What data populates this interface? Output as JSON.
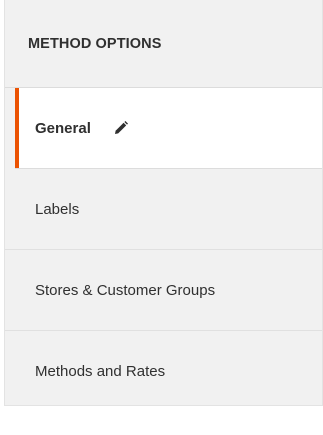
{
  "panel": {
    "title": "METHOD OPTIONS"
  },
  "nav": {
    "items": [
      {
        "label": "General",
        "active": true,
        "icon": "pencil-icon"
      },
      {
        "label": "Labels",
        "active": false
      },
      {
        "label": "Stores & Customer Groups",
        "active": false
      },
      {
        "label": "Methods and Rates",
        "active": false
      }
    ]
  },
  "colors": {
    "active_accent": "#eb5202",
    "panel_background": "#f1f1f1",
    "active_background": "#ffffff",
    "text": "#303030"
  }
}
